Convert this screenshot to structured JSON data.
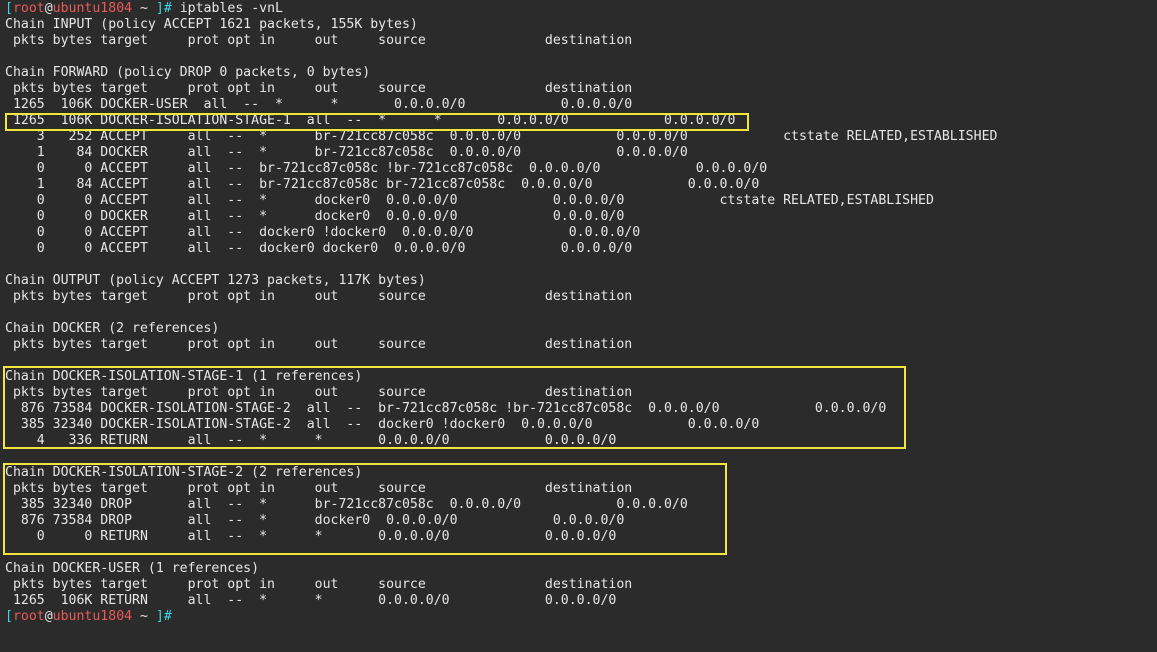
{
  "prompt": {
    "open_bracket": "[",
    "user": "root",
    "at": "@",
    "host": "ubuntu1804",
    "path": " ~ ",
    "close": "]#",
    "command": " iptables -vnL"
  },
  "lines": [
    "Chain INPUT (policy ACCEPT 1621 packets, 155K bytes)",
    " pkts bytes target     prot opt in     out     source               destination",
    "",
    "Chain FORWARD (policy DROP 0 packets, 0 bytes)",
    " pkts bytes target     prot opt in     out     source               destination",
    " 1265  106K DOCKER-USER  all  --  *      *       0.0.0.0/0            0.0.0.0/0",
    " 1265  106K DOCKER-ISOLATION-STAGE-1  all  --  *      *       0.0.0.0/0            0.0.0.0/0",
    "    3   252 ACCEPT     all  --  *      br-721cc87c058c  0.0.0.0/0            0.0.0.0/0            ctstate RELATED,ESTABLISHED",
    "    1    84 DOCKER     all  --  *      br-721cc87c058c  0.0.0.0/0            0.0.0.0/0",
    "    0     0 ACCEPT     all  --  br-721cc87c058c !br-721cc87c058c  0.0.0.0/0            0.0.0.0/0",
    "    1    84 ACCEPT     all  --  br-721cc87c058c br-721cc87c058c  0.0.0.0/0            0.0.0.0/0",
    "    0     0 ACCEPT     all  --  *      docker0  0.0.0.0/0            0.0.0.0/0            ctstate RELATED,ESTABLISHED",
    "    0     0 DOCKER     all  --  *      docker0  0.0.0.0/0            0.0.0.0/0",
    "    0     0 ACCEPT     all  --  docker0 !docker0  0.0.0.0/0            0.0.0.0/0",
    "    0     0 ACCEPT     all  --  docker0 docker0  0.0.0.0/0            0.0.0.0/0",
    "",
    "Chain OUTPUT (policy ACCEPT 1273 packets, 117K bytes)",
    " pkts bytes target     prot opt in     out     source               destination",
    "",
    "Chain DOCKER (2 references)",
    " pkts bytes target     prot opt in     out     source               destination",
    "",
    "Chain DOCKER-ISOLATION-STAGE-1 (1 references)",
    " pkts bytes target     prot opt in     out     source               destination",
    "  876 73584 DOCKER-ISOLATION-STAGE-2  all  --  br-721cc87c058c !br-721cc87c058c  0.0.0.0/0            0.0.0.0/0",
    "  385 32340 DOCKER-ISOLATION-STAGE-2  all  --  docker0 !docker0  0.0.0.0/0            0.0.0.0/0",
    "    4   336 RETURN     all  --  *      *       0.0.0.0/0            0.0.0.0/0",
    "",
    "Chain DOCKER-ISOLATION-STAGE-2 (2 references)",
    " pkts bytes target     prot opt in     out     source               destination",
    "  385 32340 DROP       all  --  *      br-721cc87c058c  0.0.0.0/0            0.0.0.0/0",
    "  876 73584 DROP       all  --  *      docker0  0.0.0.0/0            0.0.0.0/0",
    "    0     0 RETURN     all  --  *      *       0.0.0.0/0            0.0.0.0/0",
    "",
    "Chain DOCKER-USER (1 references)",
    " pkts bytes target     prot opt in     out     source               destination",
    " 1265  106K RETURN     all  --  *      *       0.0.0.0/0            0.0.0.0/0"
  ],
  "colors": {
    "background": "#2b2b2b",
    "text": "#e6e6e6",
    "prompt_bracket": "#3fd3e6",
    "prompt_user_host": "#e85a5a",
    "highlight_box": "#f2e63a"
  }
}
